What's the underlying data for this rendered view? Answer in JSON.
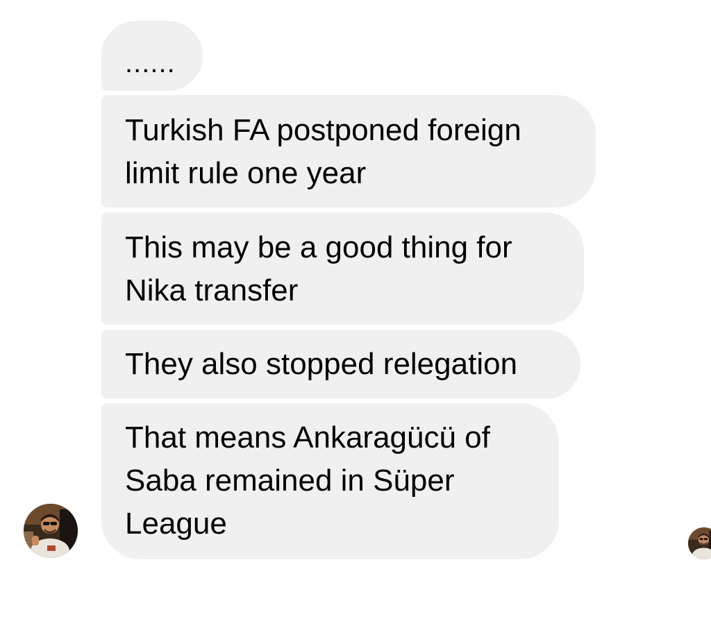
{
  "conversation": {
    "messages": [
      {
        "text": "......"
      },
      {
        "text": "Turkish FA postponed foreign\nlimit rule one year"
      },
      {
        "text": "This may be a good thing for\nNika transfer"
      },
      {
        "text": "They also stopped relegation"
      },
      {
        "text": "That means Ankaragücü of\nSaba remained in Süper\nLeague"
      }
    ],
    "sender_avatar": {
      "icon": "user-photo-avatar"
    },
    "read_receipt": {
      "icon": "read-receipt-avatar"
    }
  },
  "colors": {
    "bubble_background": "#f0f0f0",
    "text": "#000000",
    "page_background": "#ffffff"
  }
}
